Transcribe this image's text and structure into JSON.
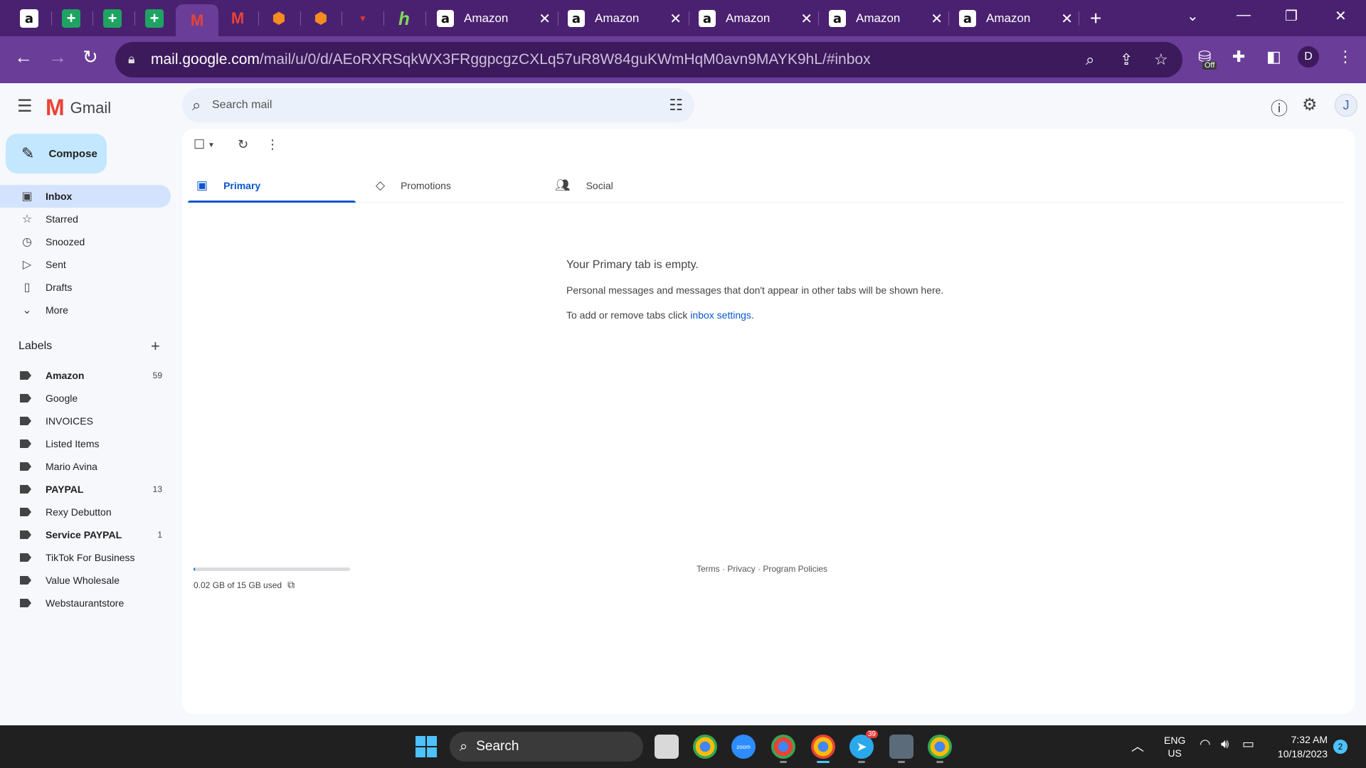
{
  "browser": {
    "pinned_tabs": [
      {
        "icon": "amazon-icon",
        "glyph": "a"
      },
      {
        "icon": "google-sheets-icon",
        "glyph": "+"
      },
      {
        "icon": "google-sheets-icon",
        "glyph": "+"
      },
      {
        "icon": "google-sheets-icon",
        "glyph": "+"
      },
      {
        "icon": "gmail-icon",
        "glyph": "M"
      },
      {
        "icon": "gmail-icon",
        "glyph": "M"
      },
      {
        "icon": "app-icon",
        "glyph": "⬢"
      },
      {
        "icon": "app-icon",
        "glyph": "⬢"
      },
      {
        "icon": "red-app-icon",
        "glyph": "▼"
      },
      {
        "icon": "green-app-icon",
        "glyph": "h"
      }
    ],
    "tabs": [
      {
        "title": "Amazon"
      },
      {
        "title": "Amazon"
      },
      {
        "title": "Amazon"
      },
      {
        "title": "Amazon"
      },
      {
        "title": "Amazon"
      }
    ],
    "url_host": "mail.google.com",
    "url_path": "/mail/u/0/d/AEoRXRSqkWX3FRggpcgzCXLq57uR8W84guKWmHqM0avn9MAYK9hL/#inbox",
    "extension_badge": "Off",
    "profile_initial": "D",
    "colors": {
      "frame": "#4a2170",
      "toolbar": "#6a3d99",
      "omnibox": "#3d1a5c"
    }
  },
  "gmail": {
    "logo_text": "Gmail",
    "search_placeholder": "Search mail",
    "avatar_initial": "J",
    "compose_label": "Compose",
    "nav": [
      {
        "label": "Inbox",
        "icon": "inbox-icon",
        "active": true
      },
      {
        "label": "Starred",
        "icon": "star-icon"
      },
      {
        "label": "Snoozed",
        "icon": "clock-icon"
      },
      {
        "label": "Sent",
        "icon": "send-icon"
      },
      {
        "label": "Drafts",
        "icon": "draft-icon"
      },
      {
        "label": "More",
        "icon": "chevron-down-icon"
      }
    ],
    "labels_heading": "Labels",
    "labels": [
      {
        "name": "Amazon",
        "count": "59",
        "bold": true
      },
      {
        "name": "Google",
        "count": ""
      },
      {
        "name": "INVOICES",
        "count": ""
      },
      {
        "name": "Listed Items",
        "count": ""
      },
      {
        "name": "Mario Avina",
        "count": ""
      },
      {
        "name": "PAYPAL",
        "count": "13",
        "bold": true
      },
      {
        "name": "Rexy Debutton",
        "count": ""
      },
      {
        "name": "Service PAYPAL",
        "count": "1",
        "bold": true
      },
      {
        "name": "TikTok For Business",
        "count": ""
      },
      {
        "name": "Value Wholesale",
        "count": ""
      },
      {
        "name": "Webstaurantstore",
        "count": ""
      }
    ],
    "category_tabs": [
      {
        "label": "Primary",
        "icon": "inbox-icon",
        "active": true
      },
      {
        "label": "Promotions",
        "icon": "tag-icon"
      },
      {
        "label": "Social",
        "icon": "people-icon"
      }
    ],
    "empty_title": "Your Primary tab is empty.",
    "empty_desc": "Personal messages and messages that don't appear in other tabs will be shown here.",
    "empty_hint_prefix": "To add or remove tabs click ",
    "empty_hint_link": "inbox settings",
    "empty_hint_suffix": ".",
    "storage_text": "0.02 GB of 15 GB used",
    "storage_used_fraction": 0.0013,
    "footer_links": "Terms · Privacy · Program Policies",
    "colors": {
      "accent": "#0b57d0",
      "compose_bg": "#c2e7ff",
      "active_nav": "#d3e3fd"
    }
  },
  "taskbar": {
    "search_label": "Search",
    "apps": [
      {
        "icon": "file-explorer-icon"
      },
      {
        "icon": "chrome-icon"
      },
      {
        "icon": "zoom-icon",
        "text": "zoom"
      },
      {
        "icon": "chrome-icon"
      },
      {
        "icon": "chrome-profile-icon",
        "active": true
      },
      {
        "icon": "telegram-icon",
        "badge": "39"
      },
      {
        "icon": "calculator-icon"
      },
      {
        "icon": "chrome-icon"
      }
    ],
    "lang_top": "ENG",
    "lang_bottom": "US",
    "time": "7:32 AM",
    "date": "10/18/2023",
    "notifications": "2"
  }
}
